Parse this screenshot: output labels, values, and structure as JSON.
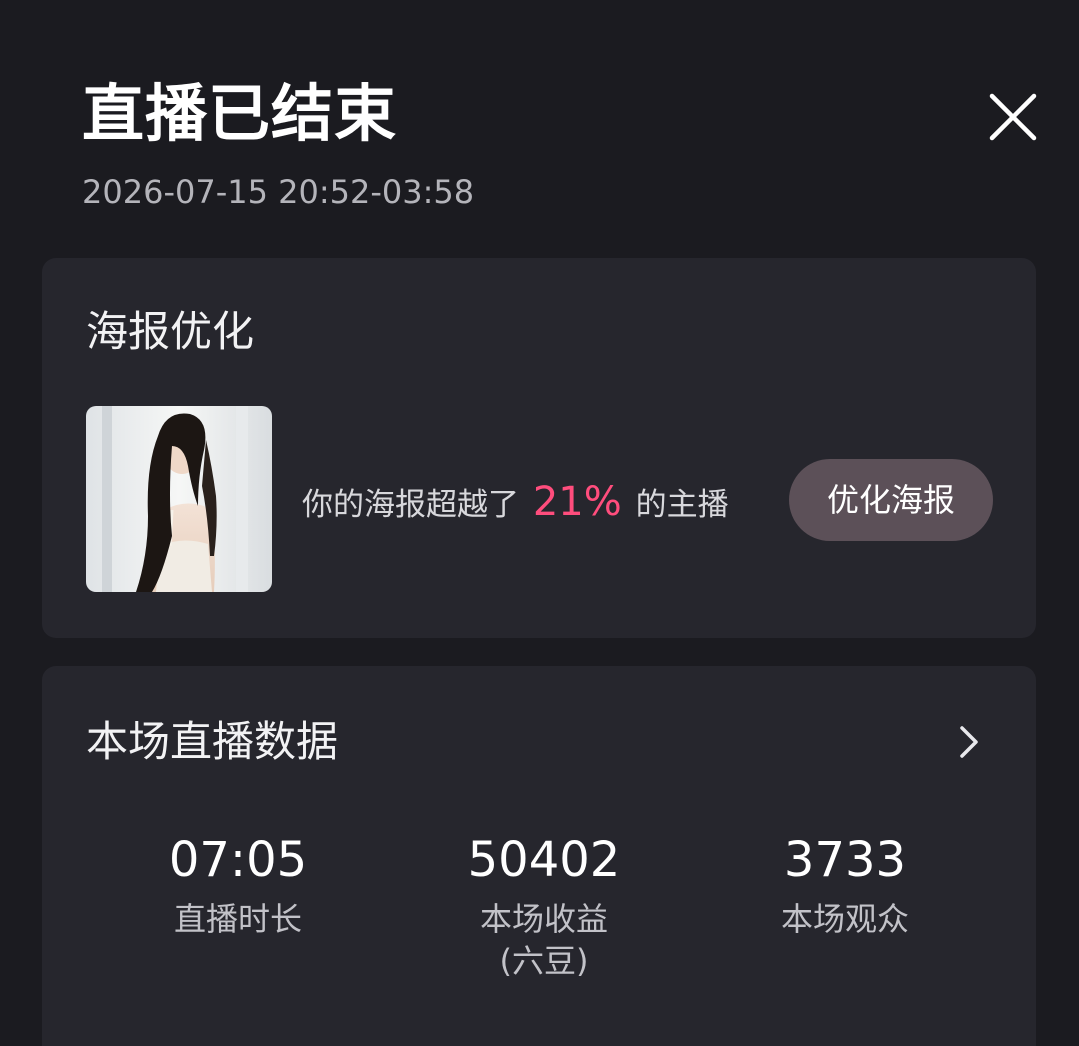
{
  "header": {
    "title": "直播已结束",
    "time_range": "2026-07-15 20:52-03:58"
  },
  "poster_card": {
    "title": "海报优化",
    "rank_prefix": "你的海报超越了",
    "rank_percent": "21%",
    "rank_suffix": "的主播",
    "button_label": "优化海报",
    "thumbnail_icon": "poster-photo-woman-long-hair"
  },
  "stats_card": {
    "title": "本场直播数据",
    "stats": [
      {
        "value": "07:05",
        "label": "直播时长"
      },
      {
        "value": "50402",
        "label": "本场收益",
        "label_line2": "(六豆)"
      },
      {
        "value": "3733",
        "label": "本场观众"
      }
    ]
  },
  "colors": {
    "background": "#1b1b20",
    "card": "#26262d",
    "accent_percent": "#ff4d7d",
    "button": "#5c5058"
  }
}
